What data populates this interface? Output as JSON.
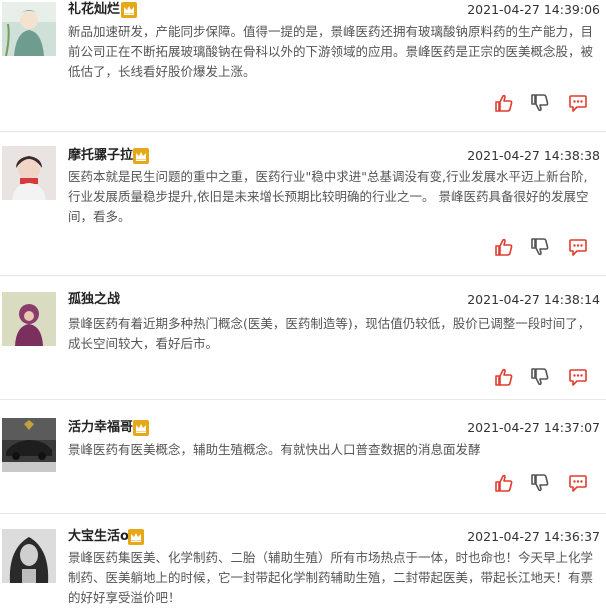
{
  "colors": {
    "accent": "#e23b2f",
    "crown": "#e6a817",
    "divider": "#e6e6e6"
  },
  "icons": {
    "like": "thumbs-up-icon",
    "dislike": "thumbs-down-icon",
    "reply": "reply-bubble-icon",
    "badge": "crown-icon"
  },
  "comments": [
    {
      "username": "礼花灿烂",
      "timestamp": "2021-04-27 14:39:06",
      "text": "新品加速研发，产能同步保障。值得一提的是，景峰医药还拥有玻璃酸钠原料药的生产能力，目前公司正在不断拓展玻璃酸钠在骨科以外的下游领域的应用。景峰医药是正宗的医美概念股，被低估了，长线看好股价爆发上涨。"
    },
    {
      "username": "摩托骡子拉",
      "timestamp": "2021-04-27 14:38:38",
      "text": "医药本就是民生问题的重中之重，医药行业\"稳中求进\"总基调没有变,行业发展水平迈上新台阶,行业发展质量稳步提升,依旧是未来增长预期比较明确的行业之一。 景峰医药具备很好的发展空间，看多。"
    },
    {
      "username": "孤独之战",
      "timestamp": "2021-04-27 14:38:14",
      "text": "景峰医药有着近期多种热门概念(医美，医药制造等)，现估值仍较低，股价已调整一段时间了，成长空间较大，看好后市。"
    },
    {
      "username": "活力幸福哥",
      "timestamp": "2021-04-27 14:37:07",
      "text": "景峰医药有医美概念，辅助生殖概念。有就快出人口普查数据的消息面发酵"
    },
    {
      "username": "大宝生活o",
      "timestamp": "2021-04-27 14:36:37",
      "text": "景峰医药集医美、化学制药、二胎（辅助生殖）所有市场热点于一体，时也命也！今天早上化学制药、医美躺地上的时候，它一封带起化学制药辅助生殖，二封带起医美，带起长江地天！有票的好好享受溢价吧！"
    }
  ]
}
